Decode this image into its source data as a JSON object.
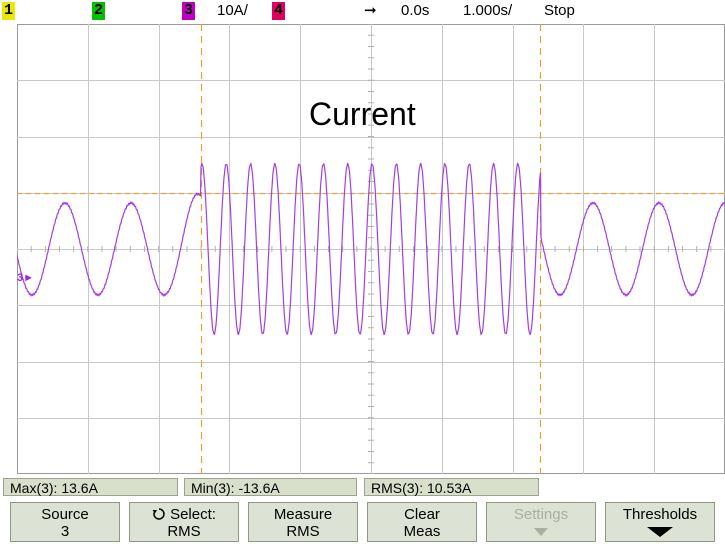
{
  "status_bar": {
    "channels": [
      {
        "label": "1",
        "color": "#e8e800"
      },
      {
        "label": "2",
        "color": "#00c000"
      },
      {
        "label": "3",
        "color": "#c000c0"
      },
      {
        "label": "4",
        "color": "#e00060"
      }
    ],
    "ch3_scale": "10A/",
    "time_delay": "0.0s",
    "time_scale": "1.000s/",
    "run_state": "Stop"
  },
  "screen": {
    "trace_label": "Current",
    "trace_color": "#a040e0",
    "cursor_color": "#f0a030"
  },
  "measurements": {
    "max": "Max(3): 13.6A",
    "min": "Min(3): -13.6A",
    "rms": "RMS(3): 10.53A"
  },
  "softkeys": {
    "source_l1": "Source",
    "source_l2": "3",
    "select_l1": "Select:",
    "select_l2": "RMS",
    "measure_l1": "Measure",
    "measure_l2": "RMS",
    "clear_l1": "Clear",
    "clear_l2": "Meas",
    "settings_l1": "Settings",
    "thresholds_l1": "Thresholds"
  }
}
